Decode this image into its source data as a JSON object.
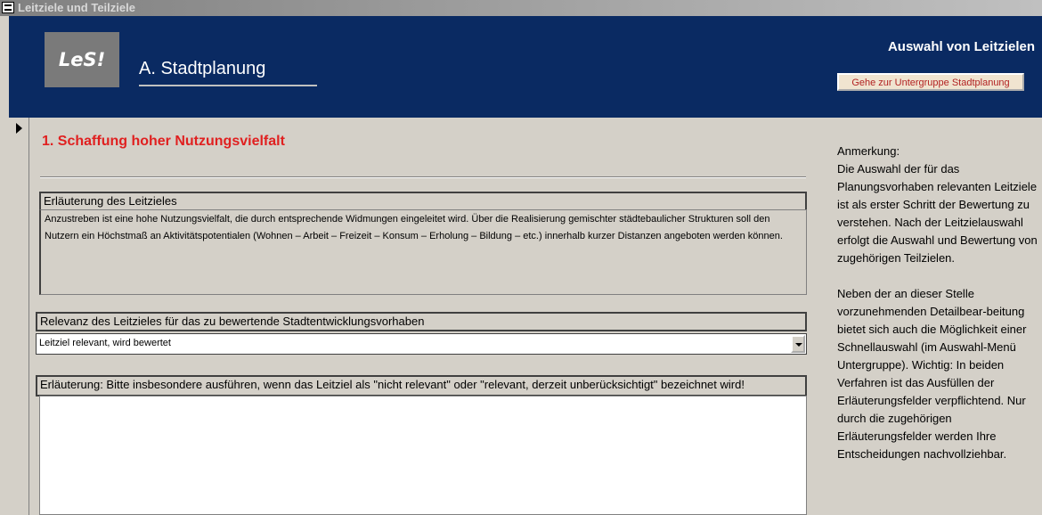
{
  "window": {
    "title": "Leitziele und Teilziele",
    "icon": "form-icon"
  },
  "header": {
    "logo_text": "LeS!",
    "section_title": "A. Stadtplanung",
    "right_title": "Auswahl von Leitzielen",
    "goto_button": "Gehe zur Untergruppe Stadtplanung",
    "colors": {
      "header_bg": "#0a2a62",
      "button_text": "#b22222"
    }
  },
  "goal": {
    "title": "1. Schaffung hoher Nutzungsvielfalt",
    "title_color": "#e02020"
  },
  "explanation": {
    "label": "Erläuterung des Leitzieles",
    "text": "Anzustreben ist eine hohe Nutzungsvielfalt, die durch entsprechende Widmungen eingeleitet wird. Über die Realisierung gemischter städtebaulicher Strukturen soll den Nutzern ein Höchstmaß an Aktivitätspotentialen (Wohnen – Arbeit – Freizeit – Konsum – Erholung – Bildung – etc.) innerhalb kurzer Distanzen angeboten werden können."
  },
  "relevance": {
    "label": "Relevanz des Leitzieles für das zu bewertende Stadtentwicklungsvorhaben",
    "selected_value": "Leitziel relevant, wird bewertet"
  },
  "comment": {
    "label": "Erläuterung: Bitte insbesondere ausführen, wenn das Leitziel als \"nicht relevant\" oder \"relevant, derzeit unberücksichtigt\" bezeichnet wird!",
    "value": ""
  },
  "remark": {
    "heading": "Anmerkung:",
    "paragraph1": "Die Auswahl der für das Planungsvorhaben relevanten Leitziele ist als erster Schritt der Bewertung zu verstehen. Nach der Leitzielauswahl erfolgt die Auswahl und Bewertung von zugehörigen Teilzielen.",
    "paragraph2": "Neben der an dieser Stelle vorzunehmenden Detailbear-beitung bietet sich auch die Möglichkeit einer Schnellauswahl (im Auswahl-Menü Untergruppe). Wichtig: In beiden Verfahren ist das Ausfüllen der Erläuterungsfelder verpflichtend. Nur durch die zugehörigen Erläuterungsfelder werden Ihre Entscheidungen nachvollziehbar."
  }
}
